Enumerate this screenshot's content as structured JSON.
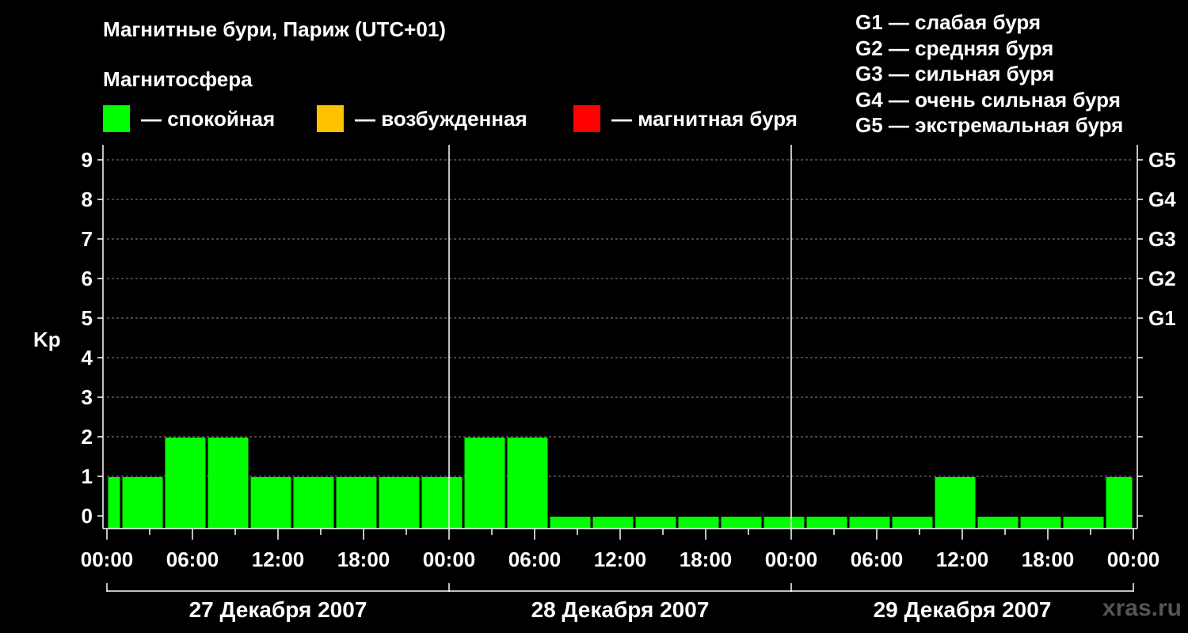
{
  "title": "Магнитные бури, Париж (UTC+01)",
  "legend": {
    "heading": "Магнитосфера",
    "items": [
      {
        "label": "— спокойная",
        "color": "#00ff00"
      },
      {
        "label": "— возбужденная",
        "color": "#ffc000"
      },
      {
        "label": "— магнитная буря",
        "color": "#ff0000"
      }
    ]
  },
  "storm_scale": [
    "G1 — слабая буря",
    "G2 — средняя буря",
    "G3 — сильная буря",
    "G4 — очень сильная буря",
    "G5 — экстремальная буря"
  ],
  "source": "xras.ru",
  "chart_data": {
    "type": "bar",
    "ylabel": "Kp",
    "ylim": [
      0,
      9
    ],
    "yticks": [
      0,
      1,
      2,
      3,
      4,
      5,
      6,
      7,
      8,
      9
    ],
    "right_axis": [
      {
        "kp": 5,
        "label": "G1"
      },
      {
        "kp": 6,
        "label": "G2"
      },
      {
        "kp": 7,
        "label": "G3"
      },
      {
        "kp": 8,
        "label": "G4"
      },
      {
        "kp": 9,
        "label": "G5"
      }
    ],
    "xtick_labels": [
      "00:00",
      "06:00",
      "12:00",
      "18:00",
      "00:00",
      "06:00",
      "12:00",
      "18:00",
      "00:00",
      "06:00",
      "12:00",
      "18:00",
      "00:00"
    ],
    "days": [
      "27 Декабря 2007",
      "28 Декабря 2007",
      "29 Декабря 2007"
    ],
    "time_offset_hours": 1,
    "interval_hours": 3,
    "values": [
      1,
      1,
      2,
      2,
      1,
      1,
      1,
      1,
      1,
      2,
      2,
      0,
      0,
      0,
      0,
      0,
      0,
      0,
      0,
      0,
      1,
      0,
      0,
      0,
      1
    ],
    "color": "#00ff00",
    "grid": true
  }
}
